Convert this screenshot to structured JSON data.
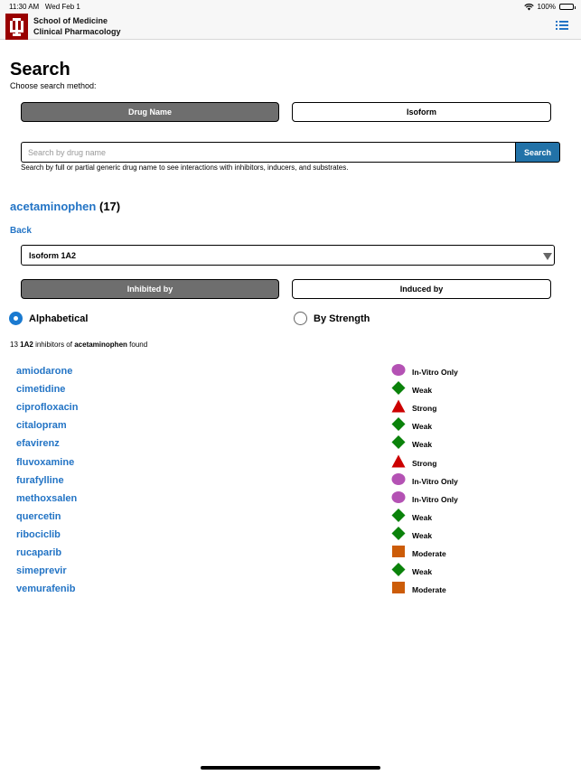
{
  "status": {
    "time": "11:30 AM",
    "date": "Wed Feb 1",
    "battery": "100%",
    "battery_level": 1.0
  },
  "header": {
    "line1": "School of Medicine",
    "line2": "Clinical Pharmacology"
  },
  "page": {
    "title": "Search",
    "subtitle": "Choose search method:"
  },
  "method_tabs": {
    "drug_name": "Drug Name",
    "isoform": "Isoform",
    "selected": "drug_name"
  },
  "search": {
    "placeholder": "Search by drug name",
    "button": "Search",
    "help": "Search by full or partial generic drug name to see interactions with inhibitors, inducers, and substrates."
  },
  "drug": {
    "name": "acetaminophen",
    "count": "(17)"
  },
  "back": "Back",
  "isoform_select": {
    "value": "Isoform 1A2"
  },
  "relation_tabs": {
    "inhibited": "Inhibited by",
    "induced": "Induced by",
    "selected": "inhibited"
  },
  "sort": {
    "alpha": "Alphabetical",
    "strength": "By Strength",
    "selected": "alpha"
  },
  "found": {
    "count": "13",
    "isoform": "1A2",
    "middle": "inhibitors of",
    "drug": "acetaminophen",
    "suffix": "found"
  },
  "colors": {
    "in_vitro": "#b452b4",
    "weak": "#0a820a",
    "strong": "#cc0000",
    "moderate": "#cc5c08",
    "link": "#2374c5",
    "brand": "#990000"
  },
  "results": [
    {
      "drug": "amiodarone",
      "strength": "In-Vitro Only",
      "icon": "circle-icon"
    },
    {
      "drug": "cimetidine",
      "strength": "Weak",
      "icon": "diamond-icon"
    },
    {
      "drug": "ciprofloxacin",
      "strength": "Strong",
      "icon": "triangle-icon"
    },
    {
      "drug": "citalopram",
      "strength": "Weak",
      "icon": "diamond-icon"
    },
    {
      "drug": "efavirenz",
      "strength": "Weak",
      "icon": "diamond-icon"
    },
    {
      "drug": "fluvoxamine",
      "strength": "Strong",
      "icon": "triangle-icon"
    },
    {
      "drug": "furafylline",
      "strength": "In-Vitro Only",
      "icon": "circle-icon"
    },
    {
      "drug": "methoxsalen",
      "strength": "In-Vitro Only",
      "icon": "circle-icon"
    },
    {
      "drug": "quercetin",
      "strength": "Weak",
      "icon": "diamond-icon"
    },
    {
      "drug": "ribociclib",
      "strength": "Weak",
      "icon": "diamond-icon"
    },
    {
      "drug": "rucaparib",
      "strength": "Moderate",
      "icon": "square-icon"
    },
    {
      "drug": "simeprevir",
      "strength": "Weak",
      "icon": "diamond-icon"
    },
    {
      "drug": "vemurafenib",
      "strength": "Moderate",
      "icon": "square-icon"
    }
  ]
}
